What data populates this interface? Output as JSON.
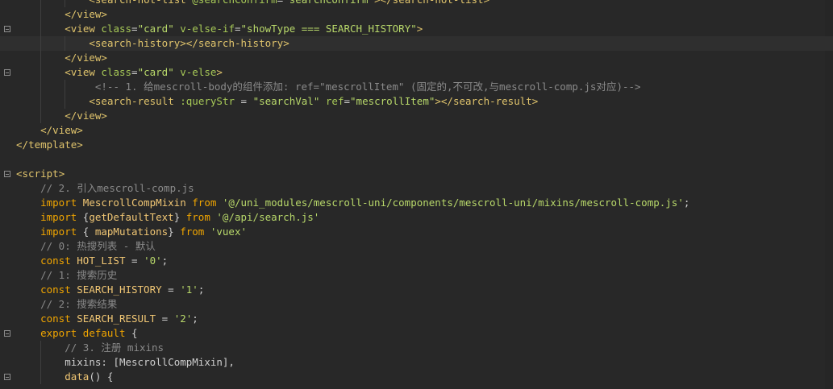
{
  "colors": {
    "background": "#282828",
    "tag": "#e0c46c",
    "attr": "#a7c957",
    "string": "#b8d86a",
    "keyword": "#f0a500",
    "comment": "#8a8a8a",
    "identifier": "#cfcfcf",
    "variable": "#f0c674"
  },
  "editor": {
    "lines": [
      {
        "fold": false,
        "indent": 3,
        "tokens": [
          {
            "t": "<",
            "c": "tag"
          },
          {
            "t": "search-hot-list",
            "c": "tag"
          },
          {
            "t": " @searchConfirm",
            "c": "attr"
          },
          {
            "t": "=",
            "c": "identifier"
          },
          {
            "t": "\"searchConfirm\"",
            "c": "string"
          },
          {
            "t": "></",
            "c": "tag"
          },
          {
            "t": "search-hot-list",
            "c": "tag"
          },
          {
            "t": ">",
            "c": "tag"
          }
        ]
      },
      {
        "fold": false,
        "indent": 2,
        "tokens": [
          {
            "t": "</",
            "c": "tag"
          },
          {
            "t": "view",
            "c": "tag"
          },
          {
            "t": ">",
            "c": "tag"
          }
        ]
      },
      {
        "fold": true,
        "indent": 2,
        "tokens": [
          {
            "t": "<",
            "c": "tag"
          },
          {
            "t": "view",
            "c": "tag"
          },
          {
            "t": " class",
            "c": "attr"
          },
          {
            "t": "=",
            "c": "identifier"
          },
          {
            "t": "\"card\"",
            "c": "string"
          },
          {
            "t": " v-else-if",
            "c": "attr"
          },
          {
            "t": "=",
            "c": "identifier"
          },
          {
            "t": "\"showType === SEARCH_HISTORY\"",
            "c": "string"
          },
          {
            "t": ">",
            "c": "tag"
          }
        ]
      },
      {
        "fold": false,
        "indent": 3,
        "highlight": true,
        "tokens": [
          {
            "t": "<",
            "c": "tag"
          },
          {
            "t": "search-history",
            "c": "tag"
          },
          {
            "t": "></",
            "c": "tag"
          },
          {
            "t": "search-history",
            "c": "tag"
          },
          {
            "t": ">",
            "c": "tag"
          }
        ]
      },
      {
        "fold": false,
        "indent": 2,
        "tokens": [
          {
            "t": "</",
            "c": "tag"
          },
          {
            "t": "view",
            "c": "tag"
          },
          {
            "t": ">",
            "c": "tag"
          }
        ]
      },
      {
        "fold": true,
        "indent": 2,
        "tokens": [
          {
            "t": "<",
            "c": "tag"
          },
          {
            "t": "view",
            "c": "tag"
          },
          {
            "t": " class",
            "c": "attr"
          },
          {
            "t": "=",
            "c": "identifier"
          },
          {
            "t": "\"card\"",
            "c": "string"
          },
          {
            "t": " v-else",
            "c": "attr"
          },
          {
            "t": ">",
            "c": "tag"
          }
        ]
      },
      {
        "fold": false,
        "indent": 3,
        "tokens": [
          {
            "t": " <!-- 1. 给mescroll-body的组件添加: ref=\"mescrollItem\" (固定的,不可改,与mescroll-comp.js对应)-->",
            "c": "comment"
          }
        ]
      },
      {
        "fold": false,
        "indent": 3,
        "tokens": [
          {
            "t": "<",
            "c": "tag"
          },
          {
            "t": "search-result",
            "c": "tag"
          },
          {
            "t": " :queryStr",
            "c": "attr"
          },
          {
            "t": " = ",
            "c": "identifier"
          },
          {
            "t": "\"searchVal\"",
            "c": "string"
          },
          {
            "t": " ref",
            "c": "attr"
          },
          {
            "t": "=",
            "c": "identifier"
          },
          {
            "t": "\"mescrollItem\"",
            "c": "string"
          },
          {
            "t": "></",
            "c": "tag"
          },
          {
            "t": "search-result",
            "c": "tag"
          },
          {
            "t": ">",
            "c": "tag"
          }
        ]
      },
      {
        "fold": false,
        "indent": 2,
        "tokens": [
          {
            "t": "</",
            "c": "tag"
          },
          {
            "t": "view",
            "c": "tag"
          },
          {
            "t": ">",
            "c": "tag"
          }
        ]
      },
      {
        "fold": false,
        "indent": 1,
        "tokens": [
          {
            "t": "</",
            "c": "tag"
          },
          {
            "t": "view",
            "c": "tag"
          },
          {
            "t": ">",
            "c": "tag"
          }
        ]
      },
      {
        "fold": false,
        "indent": 0,
        "tokens": [
          {
            "t": "</",
            "c": "tag"
          },
          {
            "t": "template",
            "c": "tag"
          },
          {
            "t": ">",
            "c": "tag"
          }
        ]
      },
      {
        "fold": false,
        "indent": 0,
        "tokens": []
      },
      {
        "fold": true,
        "indent": 0,
        "tokens": [
          {
            "t": "<",
            "c": "tag"
          },
          {
            "t": "script",
            "c": "tag"
          },
          {
            "t": ">",
            "c": "tag"
          }
        ]
      },
      {
        "fold": false,
        "indent": 1,
        "tokens": [
          {
            "t": "// 2. 引入mescroll-comp.js",
            "c": "comment"
          }
        ]
      },
      {
        "fold": false,
        "indent": 1,
        "tokens": [
          {
            "t": "import",
            "c": "keyword"
          },
          {
            "t": " MescrollCompMixin ",
            "c": "variable"
          },
          {
            "t": "from",
            "c": "keyword"
          },
          {
            "t": " '@/uni_modules/mescroll-uni/components/mescroll-uni/mixins/mescroll-comp.js'",
            "c": "string"
          },
          {
            "t": ";",
            "c": "identifier"
          }
        ]
      },
      {
        "fold": false,
        "indent": 1,
        "tokens": [
          {
            "t": "import",
            "c": "keyword"
          },
          {
            "t": " {",
            "c": "identifier"
          },
          {
            "t": "getDefaultText",
            "c": "variable"
          },
          {
            "t": "} ",
            "c": "identifier"
          },
          {
            "t": "from",
            "c": "keyword"
          },
          {
            "t": " '@/api/search.js'",
            "c": "string"
          }
        ]
      },
      {
        "fold": false,
        "indent": 1,
        "tokens": [
          {
            "t": "import",
            "c": "keyword"
          },
          {
            "t": " { ",
            "c": "identifier"
          },
          {
            "t": "mapMutations",
            "c": "variable"
          },
          {
            "t": "} ",
            "c": "identifier"
          },
          {
            "t": "from",
            "c": "keyword"
          },
          {
            "t": " 'vuex'",
            "c": "string"
          }
        ]
      },
      {
        "fold": false,
        "indent": 1,
        "tokens": [
          {
            "t": "// 0: 热搜列表 - 默认",
            "c": "comment"
          }
        ]
      },
      {
        "fold": false,
        "indent": 1,
        "tokens": [
          {
            "t": "const",
            "c": "keyword"
          },
          {
            "t": " HOT_LIST ",
            "c": "variable"
          },
          {
            "t": "= ",
            "c": "identifier"
          },
          {
            "t": "'0'",
            "c": "string"
          },
          {
            "t": ";",
            "c": "identifier"
          }
        ]
      },
      {
        "fold": false,
        "indent": 1,
        "tokens": [
          {
            "t": "// 1: 搜索历史",
            "c": "comment"
          }
        ]
      },
      {
        "fold": false,
        "indent": 1,
        "tokens": [
          {
            "t": "const",
            "c": "keyword"
          },
          {
            "t": " SEARCH_HISTORY ",
            "c": "variable"
          },
          {
            "t": "= ",
            "c": "identifier"
          },
          {
            "t": "'1'",
            "c": "string"
          },
          {
            "t": ";",
            "c": "identifier"
          }
        ]
      },
      {
        "fold": false,
        "indent": 1,
        "tokens": [
          {
            "t": "// 2: 搜索结果",
            "c": "comment"
          }
        ]
      },
      {
        "fold": false,
        "indent": 1,
        "tokens": [
          {
            "t": "const",
            "c": "keyword"
          },
          {
            "t": " SEARCH_RESULT ",
            "c": "variable"
          },
          {
            "t": "= ",
            "c": "identifier"
          },
          {
            "t": "'2'",
            "c": "string"
          },
          {
            "t": ";",
            "c": "identifier"
          }
        ]
      },
      {
        "fold": true,
        "indent": 1,
        "tokens": [
          {
            "t": "export",
            "c": "keyword"
          },
          {
            "t": " default",
            "c": "keyword"
          },
          {
            "t": " {",
            "c": "identifier"
          }
        ]
      },
      {
        "fold": false,
        "indent": 2,
        "tokens": [
          {
            "t": "// 3. 注册 mixins",
            "c": "comment"
          }
        ]
      },
      {
        "fold": false,
        "indent": 2,
        "tokens": [
          {
            "t": "mixins",
            "c": "identifier"
          },
          {
            "t": ": [",
            "c": "identifier"
          },
          {
            "t": "MescrollCompMixin",
            "c": "identifier"
          },
          {
            "t": "],",
            "c": "identifier"
          }
        ]
      },
      {
        "fold": true,
        "indent": 2,
        "tokens": [
          {
            "t": "data",
            "c": "variable"
          },
          {
            "t": "() {",
            "c": "identifier"
          }
        ]
      }
    ]
  }
}
